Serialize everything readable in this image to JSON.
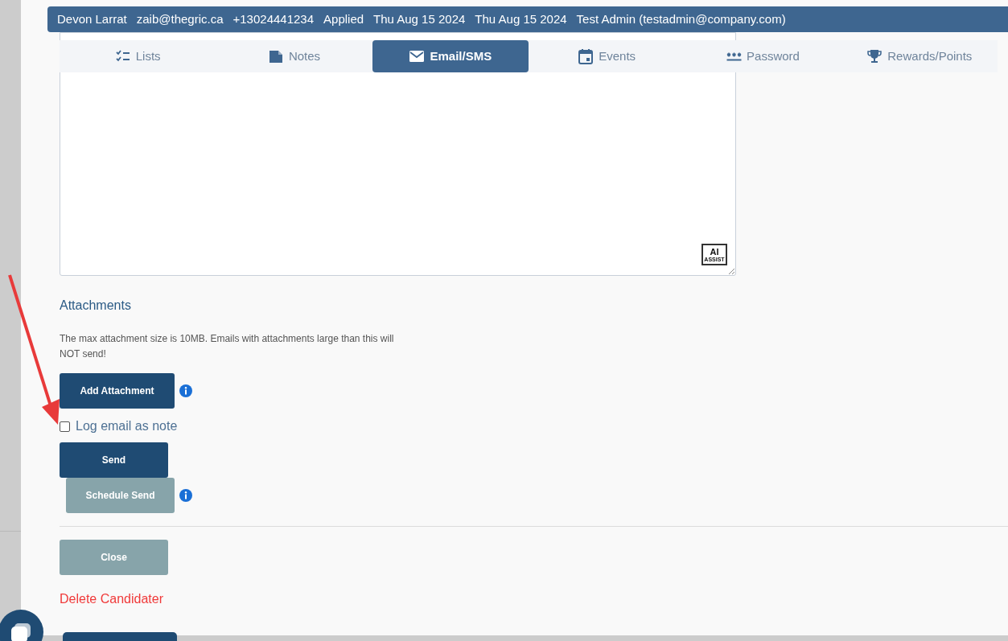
{
  "header": [
    "Devon Larrat",
    "zaib@thegric.ca",
    "+13024441234",
    "Applied",
    "Thu Aug 15 2024",
    "Thu Aug 15 2024",
    "Test Admin (testadmin@company.com)"
  ],
  "tabs": [
    {
      "label": "Lists",
      "selected": false
    },
    {
      "label": "Notes",
      "selected": false
    },
    {
      "label": "Email/SMS",
      "selected": true
    },
    {
      "label": "Events",
      "selected": false
    },
    {
      "label": "Password",
      "selected": false
    },
    {
      "label": "Rewards/Points",
      "selected": false
    }
  ],
  "editor": {
    "ai_badge": [
      "AI",
      "ASSIST"
    ]
  },
  "attachments": {
    "title": "Attachments",
    "note": "The max attachment size is 10MB. Emails with attachments large than this will NOT send!",
    "button": "Add Attachment"
  },
  "log_note": {
    "label": "Log email as note",
    "checked": false
  },
  "send_button": "Send",
  "schedule_button": "Schedule Send",
  "close_button": "Close",
  "delete_link": "Delete Candidater"
}
